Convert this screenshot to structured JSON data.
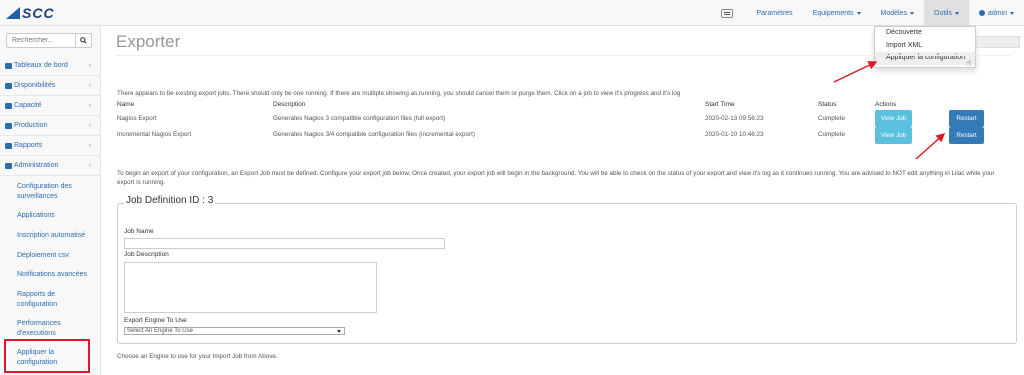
{
  "logo": {
    "text": "SCC"
  },
  "navbar": {
    "items": [
      {
        "label": "Paramètres",
        "caret": false
      },
      {
        "label": "Equipements",
        "caret": true
      },
      {
        "label": "Modèles",
        "caret": true
      },
      {
        "label": "Outils",
        "caret": true
      },
      {
        "label": "admin",
        "caret": true
      }
    ]
  },
  "tools_menu": {
    "items": [
      "Découverte",
      "Import XML",
      "Appliquer la configuration"
    ]
  },
  "sidebar": {
    "search_placeholder": "Rechercher...",
    "items": [
      {
        "label": "Tableaux de bord"
      },
      {
        "label": "Disponibilités"
      },
      {
        "label": "Capacité"
      },
      {
        "label": "Production"
      },
      {
        "label": "Rapports"
      },
      {
        "label": "Administration"
      }
    ],
    "sub_items": [
      "Configuration des surveillances",
      "Applications",
      "Inscription automatisé",
      "Déploiement csv",
      "Notifications avancées",
      "Rapports de configuration",
      "Performances d'executions",
      "Appliquer la configuration"
    ]
  },
  "main": {
    "title": "Exporter",
    "intro": "There appears to be existing export jobs. There should only be one running. If there are multiple showing as running, you should cancel them or purge them. Click on a job to view it's progress and it's log",
    "table": {
      "headers": [
        "Name",
        "Description",
        "Start Time",
        "Status",
        "Actions"
      ],
      "rows": [
        {
          "name": "Nagios Export",
          "description": "Generates Nagios 3 compatible configuration files (full export)",
          "start": "2020-02-13 09:56:23",
          "status": "Complete",
          "view": "View Job",
          "restart": "Restart"
        },
        {
          "name": "Incremental Nagios Export",
          "description": "Generates Nagios 3/4 compatible configuration files (incremental export)",
          "start": "2020-01-10 10:46:23",
          "status": "Complete",
          "view": "View Job",
          "restart": "Restart"
        }
      ]
    },
    "define_text": "To begin an export of your configuration, an Export Job must be defined. Configure your export job below. Once created, your export job will begin in the background. You will be able to check on the status of your export and view it's log as it continues running. You are advised to NOT edit anything in Lilac while your export is running.",
    "form": {
      "legend": "Job Definition ID : 3",
      "job_name_label": "Job Name",
      "job_description_label": "Job Description",
      "engine_label": "Export Engine To Use",
      "engine_selected": "Select An Engine To Use"
    },
    "footer_text": "Choose an Engine to use for your Import Job from Above."
  }
}
